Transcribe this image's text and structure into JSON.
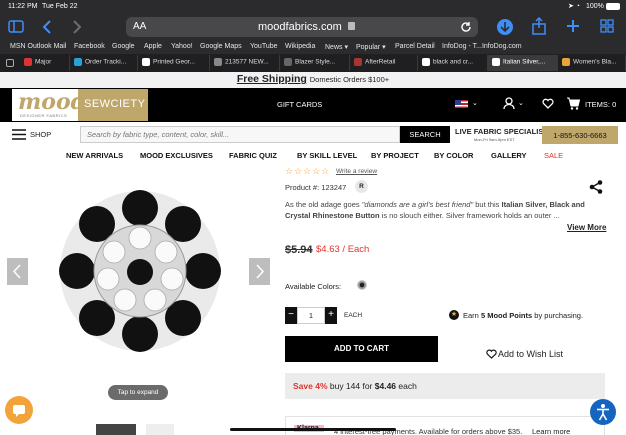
{
  "status": {
    "time": "11:22 PM",
    "date": "Tue Feb 22",
    "battery": "100%"
  },
  "browser": {
    "text_size": "AA",
    "url": "moodfabrics.com"
  },
  "bookmarks": [
    "MSN Outlook Mail",
    "Facebook",
    "Google",
    "Apple",
    "Yahoo!",
    "Google Maps",
    "YouTube",
    "Wikipedia",
    "News ▾",
    "Popular ▾",
    "Parcel Detail",
    "InfoDog - T...InfoDog.com"
  ],
  "tabs": [
    "Major",
    "Order Tracki...",
    "Printed Geor...",
    "213577 NEW...",
    "Blazer Style...",
    "AfterRetail",
    "black and cr...",
    "Italian Silver,...",
    "Women's Bla..."
  ],
  "promo": {
    "bold": "Free Shipping",
    "rest": "Domestic Orders $100+"
  },
  "header": {
    "logo_mood": "mood",
    "logo_sub": "DESIGNER FABRICS",
    "sewciety": "SEWCIETY",
    "gift_cards": "GIFT CARDS",
    "items": "ITEMS: 0"
  },
  "search": {
    "shop": "SHOP",
    "placeholder": "Search by fabric type, content, color, skill...",
    "button": "SEARCH",
    "specialist": "LIVE FABRIC SPECIALIST",
    "hours": "Mon-Fri 9am-5pm EST",
    "phone": "1-855-630-6663"
  },
  "nav": [
    "NEW ARRIVALS",
    "MOOD EXCLUSIVES",
    "FABRIC QUIZ",
    "BY SKILL LEVEL",
    "BY PROJECT",
    "BY COLOR",
    "GALLERY",
    "SALE"
  ],
  "product": {
    "write_review": "Write a review",
    "product_num": "Product #: 123247",
    "r": "R",
    "d1": "As the old adage goes ",
    "d_quote": "\"diamonds are a girl's best friend\"",
    "d2": " but this ",
    "d_bold": "Italian Silver, Black and Crystal Rhinestone Button",
    "d3": " is no slouch either. Silver framework holds an outer ...",
    "view_more": "View More",
    "old_price": "$5.94",
    "new_price": "$4.63 / Each",
    "avail_colors": "Available Colors:",
    "qty": "1",
    "each": "EACH",
    "earn_pre": "Earn ",
    "earn_points": "5 Mood Points",
    "earn_post": " by purchasing.",
    "add_cart": "ADD TO CART",
    "wishlist": "Add to Wish List",
    "save_pct": "Save 4%",
    "save_mid": " buy 144 for ",
    "save_price": "$4.46",
    "save_end": " each",
    "klarna": "Klarna.",
    "klarna_text": "4 interest-free payments. Available for orders above $35.",
    "learn_more": "Learn more",
    "tap_expand": "Tap to expand"
  },
  "colors": {
    "accent": "#e0352b",
    "gold": "#bfa66b",
    "orange": "#f2a33a",
    "header_bg": "#000000"
  }
}
